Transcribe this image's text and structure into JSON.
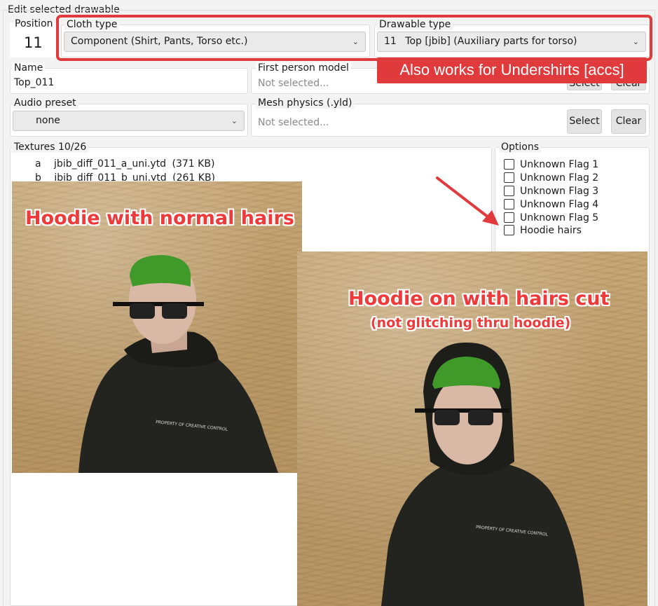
{
  "window": {
    "title": "Edit selected drawable"
  },
  "position": {
    "label": "Position",
    "value": "11"
  },
  "cloth_type": {
    "label": "Cloth type",
    "selected": "Component (Shirt, Pants, Torso etc.)"
  },
  "drawable_type": {
    "label": "Drawable type",
    "index": "11",
    "selected": "Top [jbib] (Auxiliary parts for torso)"
  },
  "annotation_banner": "Also works for Undershirts [accs]",
  "name": {
    "label": "Name",
    "value": "Top_011"
  },
  "first_person_model": {
    "label": "First person model",
    "placeholder": "Not selected...",
    "select_label": "Select",
    "clear_label": "Clear"
  },
  "audio_preset": {
    "label": "Audio preset",
    "selected": "none"
  },
  "mesh_physics": {
    "label": "Mesh physics (.yld)",
    "placeholder": "Not selected...",
    "select_label": "Select",
    "clear_label": "Clear"
  },
  "textures": {
    "label": "Textures 10/26",
    "items": [
      {
        "letter": "a",
        "file": "jbib_diff_011_a_uni.ytd",
        "size": "(371 KB)"
      },
      {
        "letter": "b",
        "file": "jbib_diff_011_b_uni.ytd",
        "size": "(261 KB)"
      }
    ]
  },
  "options": {
    "label": "Options",
    "flags": [
      {
        "label": "Unknown Flag 1",
        "checked": false
      },
      {
        "label": "Unknown Flag 2",
        "checked": false
      },
      {
        "label": "Unknown Flag 3",
        "checked": false
      },
      {
        "label": "Unknown Flag 4",
        "checked": false
      },
      {
        "label": "Unknown Flag 5",
        "checked": false
      },
      {
        "label": "Hoodie hairs",
        "checked": false
      }
    ]
  },
  "photo_left": {
    "caption": "Hoodie with normal hairs",
    "print_text": "PROPERTY OF CREATIVE CONTROL"
  },
  "photo_right": {
    "caption_line1": "Hoodie on with hairs cut",
    "caption_line2": "(not glitching thru hoodie)",
    "print_text": "PROPERTY OF CREATIVE CONTROL"
  },
  "colors": {
    "accent_red": "#e03a3c",
    "hair_green": "#3f9a2a",
    "hoodie": "#23241f"
  }
}
